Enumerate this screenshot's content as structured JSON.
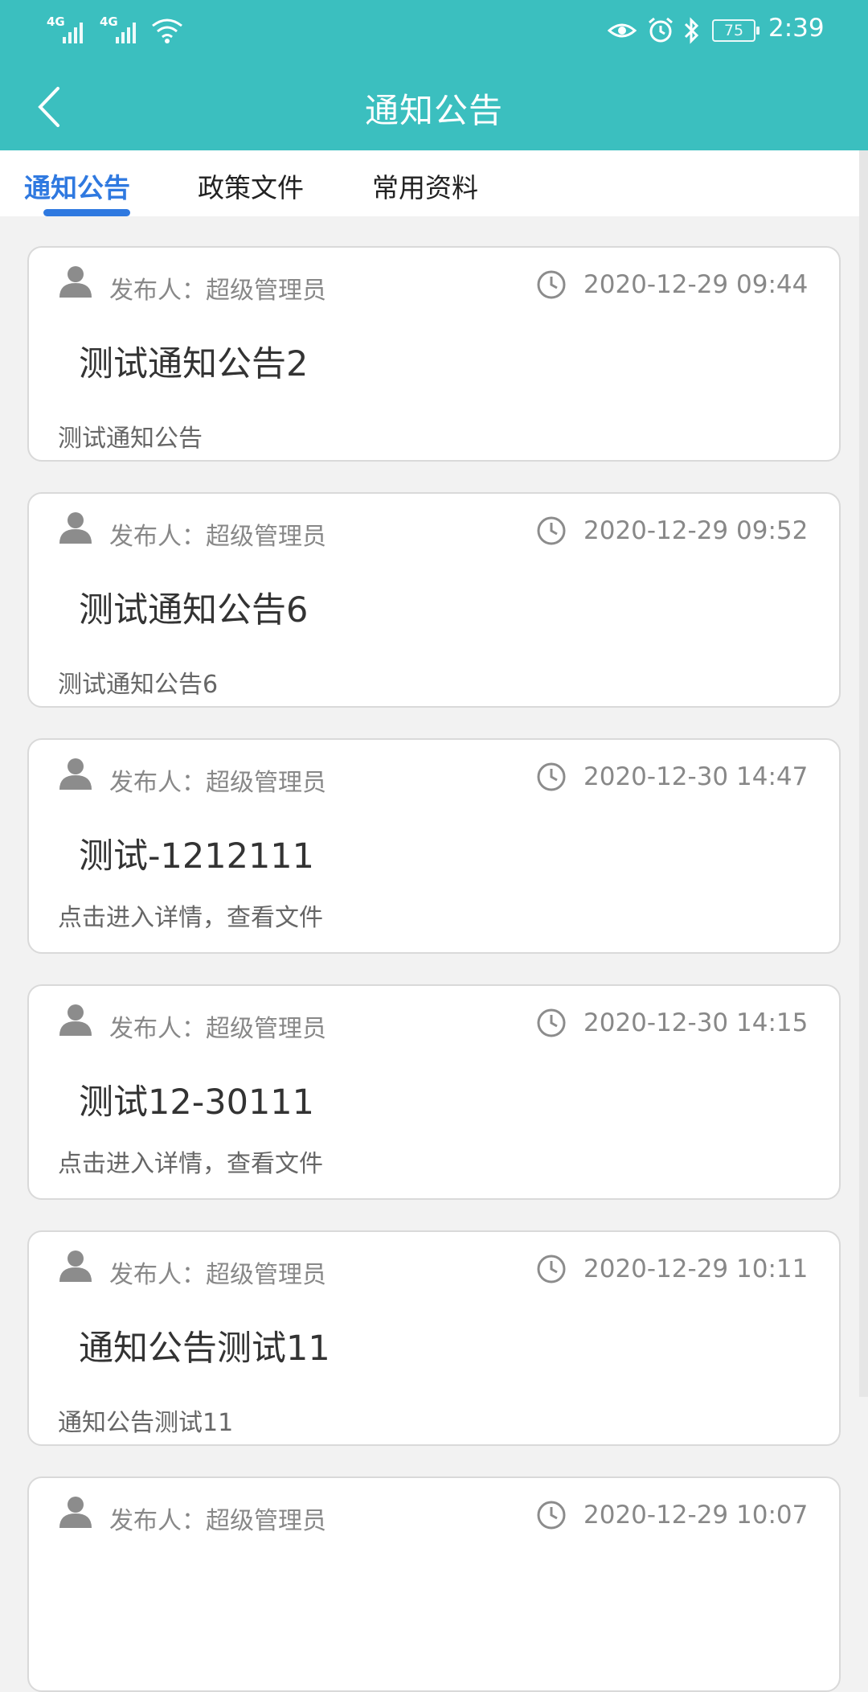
{
  "status_bar": {
    "signal_1": "4G",
    "signal_2": "4G",
    "battery": "75",
    "time": "2:39",
    "icons": [
      "signal-icon",
      "signal-icon",
      "wifi-icon",
      "eye-icon",
      "alarm-icon",
      "bluetooth-icon",
      "battery-icon"
    ]
  },
  "header": {
    "title": "通知公告",
    "back_icon": "chevron-left-icon"
  },
  "tabs": [
    {
      "label": "通知公告",
      "active": true
    },
    {
      "label": "政策文件",
      "active": false
    },
    {
      "label": "常用资料",
      "active": false
    }
  ],
  "colors": {
    "header_bg": "#3bbfbf",
    "accent": "#2f79e0"
  },
  "notices": [
    {
      "publisher": "发布人：超级管理员",
      "date": "2020-12-29 09:44",
      "title": "测试通知公告2",
      "summary": "测试通知公告"
    },
    {
      "publisher": "发布人：超级管理员",
      "date": "2020-12-29 09:52",
      "title": "测试通知公告6",
      "summary": "测试通知公告6"
    },
    {
      "publisher": "发布人：超级管理员",
      "date": "2020-12-30 14:47",
      "title": "测试-1212111",
      "summary": "点击进入详情，查看文件"
    },
    {
      "publisher": "发布人：超级管理员",
      "date": "2020-12-30 14:15",
      "title": "测试12-30111",
      "summary": "点击进入详情，查看文件"
    },
    {
      "publisher": "发布人：超级管理员",
      "date": "2020-12-29 10:11",
      "title": "通知公告测试11",
      "summary": "通知公告测试11"
    },
    {
      "publisher": "发布人：超级管理员",
      "date": "2020-12-29 10:07",
      "title": "",
      "summary": ""
    }
  ]
}
